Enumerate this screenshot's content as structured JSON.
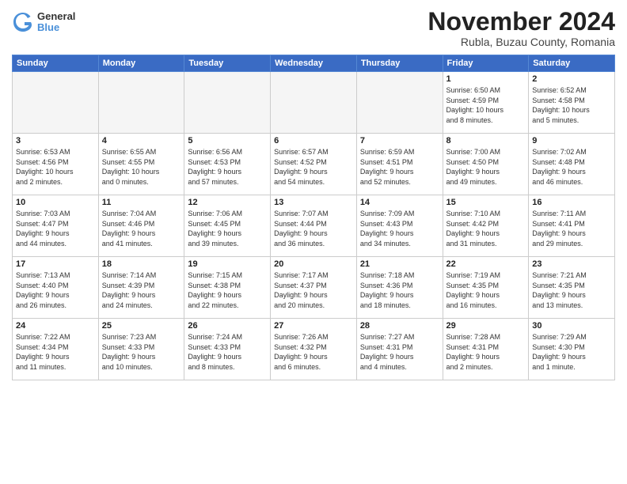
{
  "logo": {
    "general": "General",
    "blue": "Blue"
  },
  "header": {
    "title": "November 2024",
    "subtitle": "Rubla, Buzau County, Romania"
  },
  "weekdays": [
    "Sunday",
    "Monday",
    "Tuesday",
    "Wednesday",
    "Thursday",
    "Friday",
    "Saturday"
  ],
  "weeks": [
    [
      {
        "day": "",
        "info": ""
      },
      {
        "day": "",
        "info": ""
      },
      {
        "day": "",
        "info": ""
      },
      {
        "day": "",
        "info": ""
      },
      {
        "day": "",
        "info": ""
      },
      {
        "day": "1",
        "info": "Sunrise: 6:50 AM\nSunset: 4:59 PM\nDaylight: 10 hours\nand 8 minutes."
      },
      {
        "day": "2",
        "info": "Sunrise: 6:52 AM\nSunset: 4:58 PM\nDaylight: 10 hours\nand 5 minutes."
      }
    ],
    [
      {
        "day": "3",
        "info": "Sunrise: 6:53 AM\nSunset: 4:56 PM\nDaylight: 10 hours\nand 2 minutes."
      },
      {
        "day": "4",
        "info": "Sunrise: 6:55 AM\nSunset: 4:55 PM\nDaylight: 10 hours\nand 0 minutes."
      },
      {
        "day": "5",
        "info": "Sunrise: 6:56 AM\nSunset: 4:53 PM\nDaylight: 9 hours\nand 57 minutes."
      },
      {
        "day": "6",
        "info": "Sunrise: 6:57 AM\nSunset: 4:52 PM\nDaylight: 9 hours\nand 54 minutes."
      },
      {
        "day": "7",
        "info": "Sunrise: 6:59 AM\nSunset: 4:51 PM\nDaylight: 9 hours\nand 52 minutes."
      },
      {
        "day": "8",
        "info": "Sunrise: 7:00 AM\nSunset: 4:50 PM\nDaylight: 9 hours\nand 49 minutes."
      },
      {
        "day": "9",
        "info": "Sunrise: 7:02 AM\nSunset: 4:48 PM\nDaylight: 9 hours\nand 46 minutes."
      }
    ],
    [
      {
        "day": "10",
        "info": "Sunrise: 7:03 AM\nSunset: 4:47 PM\nDaylight: 9 hours\nand 44 minutes."
      },
      {
        "day": "11",
        "info": "Sunrise: 7:04 AM\nSunset: 4:46 PM\nDaylight: 9 hours\nand 41 minutes."
      },
      {
        "day": "12",
        "info": "Sunrise: 7:06 AM\nSunset: 4:45 PM\nDaylight: 9 hours\nand 39 minutes."
      },
      {
        "day": "13",
        "info": "Sunrise: 7:07 AM\nSunset: 4:44 PM\nDaylight: 9 hours\nand 36 minutes."
      },
      {
        "day": "14",
        "info": "Sunrise: 7:09 AM\nSunset: 4:43 PM\nDaylight: 9 hours\nand 34 minutes."
      },
      {
        "day": "15",
        "info": "Sunrise: 7:10 AM\nSunset: 4:42 PM\nDaylight: 9 hours\nand 31 minutes."
      },
      {
        "day": "16",
        "info": "Sunrise: 7:11 AM\nSunset: 4:41 PM\nDaylight: 9 hours\nand 29 minutes."
      }
    ],
    [
      {
        "day": "17",
        "info": "Sunrise: 7:13 AM\nSunset: 4:40 PM\nDaylight: 9 hours\nand 26 minutes."
      },
      {
        "day": "18",
        "info": "Sunrise: 7:14 AM\nSunset: 4:39 PM\nDaylight: 9 hours\nand 24 minutes."
      },
      {
        "day": "19",
        "info": "Sunrise: 7:15 AM\nSunset: 4:38 PM\nDaylight: 9 hours\nand 22 minutes."
      },
      {
        "day": "20",
        "info": "Sunrise: 7:17 AM\nSunset: 4:37 PM\nDaylight: 9 hours\nand 20 minutes."
      },
      {
        "day": "21",
        "info": "Sunrise: 7:18 AM\nSunset: 4:36 PM\nDaylight: 9 hours\nand 18 minutes."
      },
      {
        "day": "22",
        "info": "Sunrise: 7:19 AM\nSunset: 4:35 PM\nDaylight: 9 hours\nand 16 minutes."
      },
      {
        "day": "23",
        "info": "Sunrise: 7:21 AM\nSunset: 4:35 PM\nDaylight: 9 hours\nand 13 minutes."
      }
    ],
    [
      {
        "day": "24",
        "info": "Sunrise: 7:22 AM\nSunset: 4:34 PM\nDaylight: 9 hours\nand 11 minutes."
      },
      {
        "day": "25",
        "info": "Sunrise: 7:23 AM\nSunset: 4:33 PM\nDaylight: 9 hours\nand 10 minutes."
      },
      {
        "day": "26",
        "info": "Sunrise: 7:24 AM\nSunset: 4:33 PM\nDaylight: 9 hours\nand 8 minutes."
      },
      {
        "day": "27",
        "info": "Sunrise: 7:26 AM\nSunset: 4:32 PM\nDaylight: 9 hours\nand 6 minutes."
      },
      {
        "day": "28",
        "info": "Sunrise: 7:27 AM\nSunset: 4:31 PM\nDaylight: 9 hours\nand 4 minutes."
      },
      {
        "day": "29",
        "info": "Sunrise: 7:28 AM\nSunset: 4:31 PM\nDaylight: 9 hours\nand 2 minutes."
      },
      {
        "day": "30",
        "info": "Sunrise: 7:29 AM\nSunset: 4:30 PM\nDaylight: 9 hours\nand 1 minute."
      }
    ]
  ]
}
